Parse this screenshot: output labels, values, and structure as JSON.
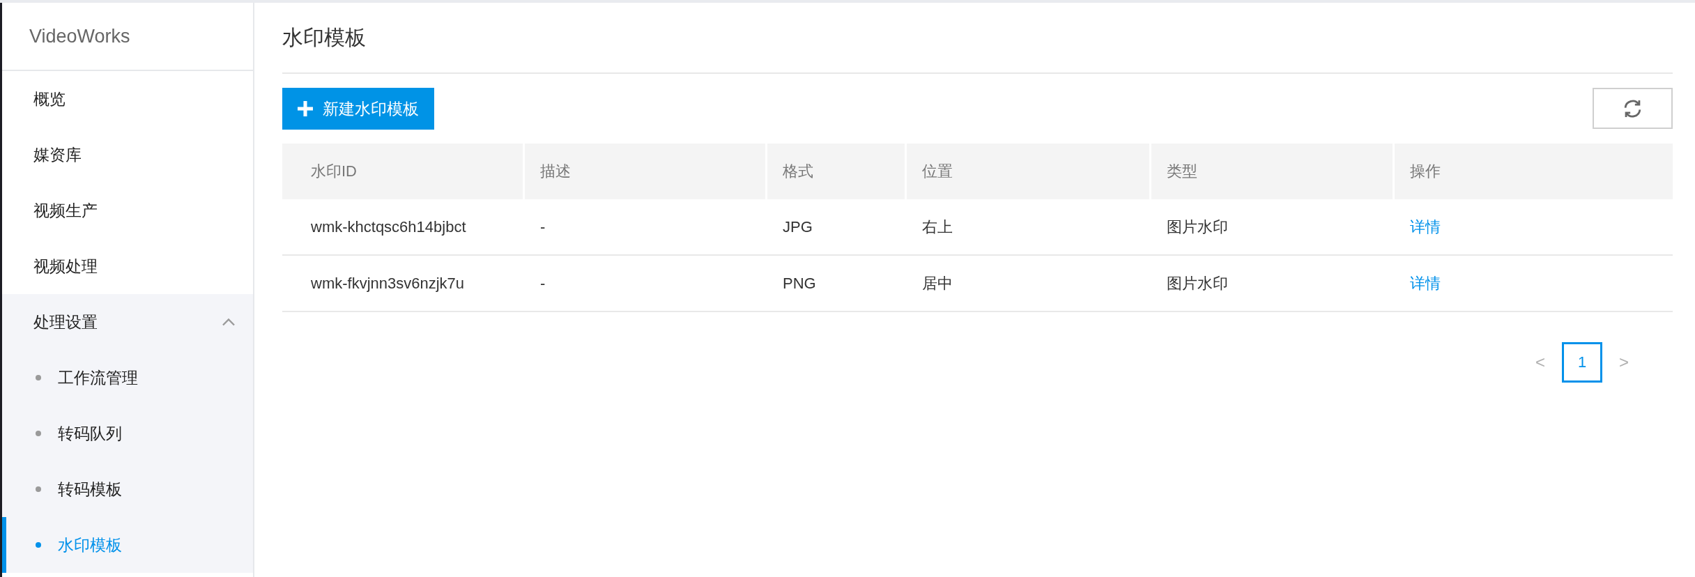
{
  "sidebar": {
    "brand": "VideoWorks",
    "items": [
      {
        "kind": "link",
        "label": "概览",
        "selected": false
      },
      {
        "kind": "link",
        "label": "媒资库",
        "selected": false
      },
      {
        "kind": "link",
        "label": "视频生产",
        "selected": false
      },
      {
        "kind": "link",
        "label": "视频处理",
        "selected": false
      },
      {
        "kind": "group",
        "label": "处理设置",
        "selected": false,
        "expanded": true,
        "children": [
          {
            "label": "工作流管理",
            "selected": false
          },
          {
            "label": "转码队列",
            "selected": false
          },
          {
            "label": "转码模板",
            "selected": false
          },
          {
            "label": "水印模板",
            "selected": true
          }
        ]
      }
    ]
  },
  "page": {
    "title": "水印模板"
  },
  "toolbar": {
    "create_button": {
      "label": "新建水印模板"
    }
  },
  "table": {
    "columns": [
      {
        "label": "水印ID",
        "kind": "text"
      },
      {
        "label": "描述",
        "kind": "text"
      },
      {
        "label": "格式",
        "kind": "text"
      },
      {
        "label": "位置",
        "kind": "text"
      },
      {
        "label": "类型",
        "kind": "text"
      },
      {
        "label": "操作",
        "kind": "link"
      }
    ],
    "rows": [
      {
        "cells": [
          "wmk-khctqsc6h14bjbct",
          "-",
          "JPG",
          "右上",
          "图片水印",
          "详情"
        ]
      },
      {
        "cells": [
          "wmk-fkvjnn3sv6nzjk7u",
          "-",
          "PNG",
          "居中",
          "图片水印",
          "详情"
        ]
      }
    ]
  },
  "pagination": {
    "prev": {
      "label": "<",
      "disabled": true
    },
    "pages": [
      {
        "label": "1",
        "selected": true
      }
    ],
    "next": {
      "label": ">",
      "disabled": true
    }
  }
}
